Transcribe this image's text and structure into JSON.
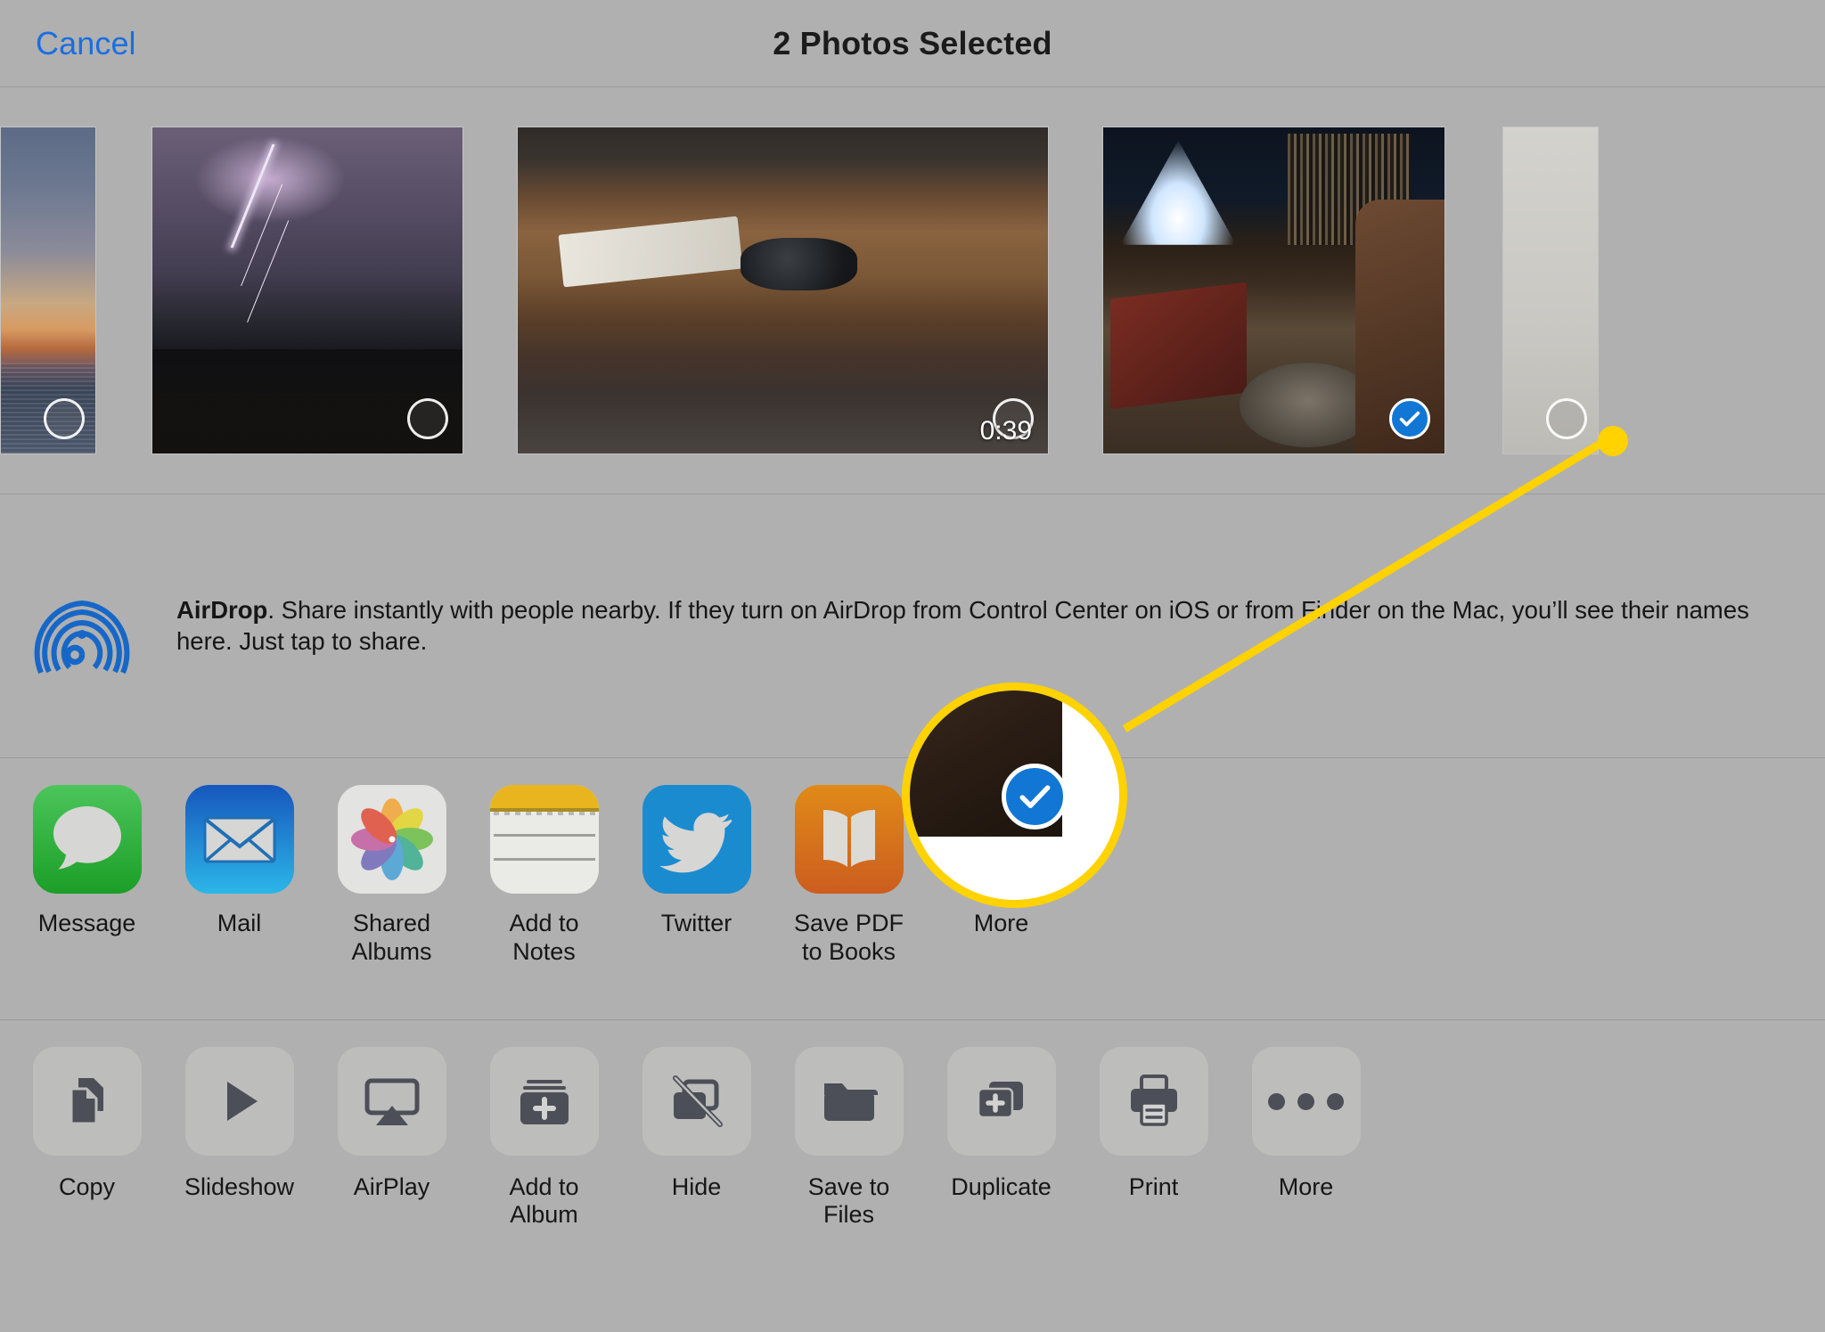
{
  "header": {
    "cancel_label": "Cancel",
    "title": "2 Photos Selected"
  },
  "accent_colors": {
    "link_blue": "#1a6ee0",
    "selected_blue": "#1277d4",
    "callout_yellow": "#ffd200",
    "sheet_background": "#b0b0b0"
  },
  "thumbnails": [
    {
      "name": "sunset-over-water",
      "selected": false,
      "duration": ""
    },
    {
      "name": "lightning-storm",
      "selected": false,
      "duration": ""
    },
    {
      "name": "table-with-items-video",
      "selected": false,
      "duration": "0:39"
    },
    {
      "name": "living-room-with-dog",
      "selected": true,
      "duration": ""
    },
    {
      "name": "bright-photo",
      "selected": false,
      "duration": ""
    }
  ],
  "airdrop": {
    "title": "AirDrop",
    "description": ". Share instantly with people nearby. If they turn on AirDrop from Control Center on iOS or from Finder on the Mac, you’ll see their names here. Just tap to share.",
    "icon": "airdrop-icon"
  },
  "apps": [
    {
      "label": "Message",
      "icon": "messages-icon"
    },
    {
      "label": "Mail",
      "icon": "mail-icon"
    },
    {
      "label": "Shared Albums",
      "icon": "photos-icon"
    },
    {
      "label": "Add to Notes",
      "icon": "notes-icon"
    },
    {
      "label": "Twitter",
      "icon": "twitter-icon"
    },
    {
      "label": "Save PDF\nto Books",
      "icon": "books-icon"
    },
    {
      "label": "More",
      "icon": "more-icon"
    }
  ],
  "actions": [
    {
      "label": "Copy",
      "icon": "copy-icon"
    },
    {
      "label": "Slideshow",
      "icon": "play-icon"
    },
    {
      "label": "AirPlay",
      "icon": "airplay-icon"
    },
    {
      "label": "Add to Album",
      "icon": "add-to-album-icon"
    },
    {
      "label": "Hide",
      "icon": "hide-icon"
    },
    {
      "label": "Save to Files",
      "icon": "folder-icon"
    },
    {
      "label": "Duplicate",
      "icon": "duplicate-icon"
    },
    {
      "label": "Print",
      "icon": "printer-icon"
    },
    {
      "label": "More",
      "icon": "more-icon"
    }
  ],
  "callout": {
    "type": "magnifier-annotation",
    "target": "selected-checkmark-on-photo-4"
  }
}
